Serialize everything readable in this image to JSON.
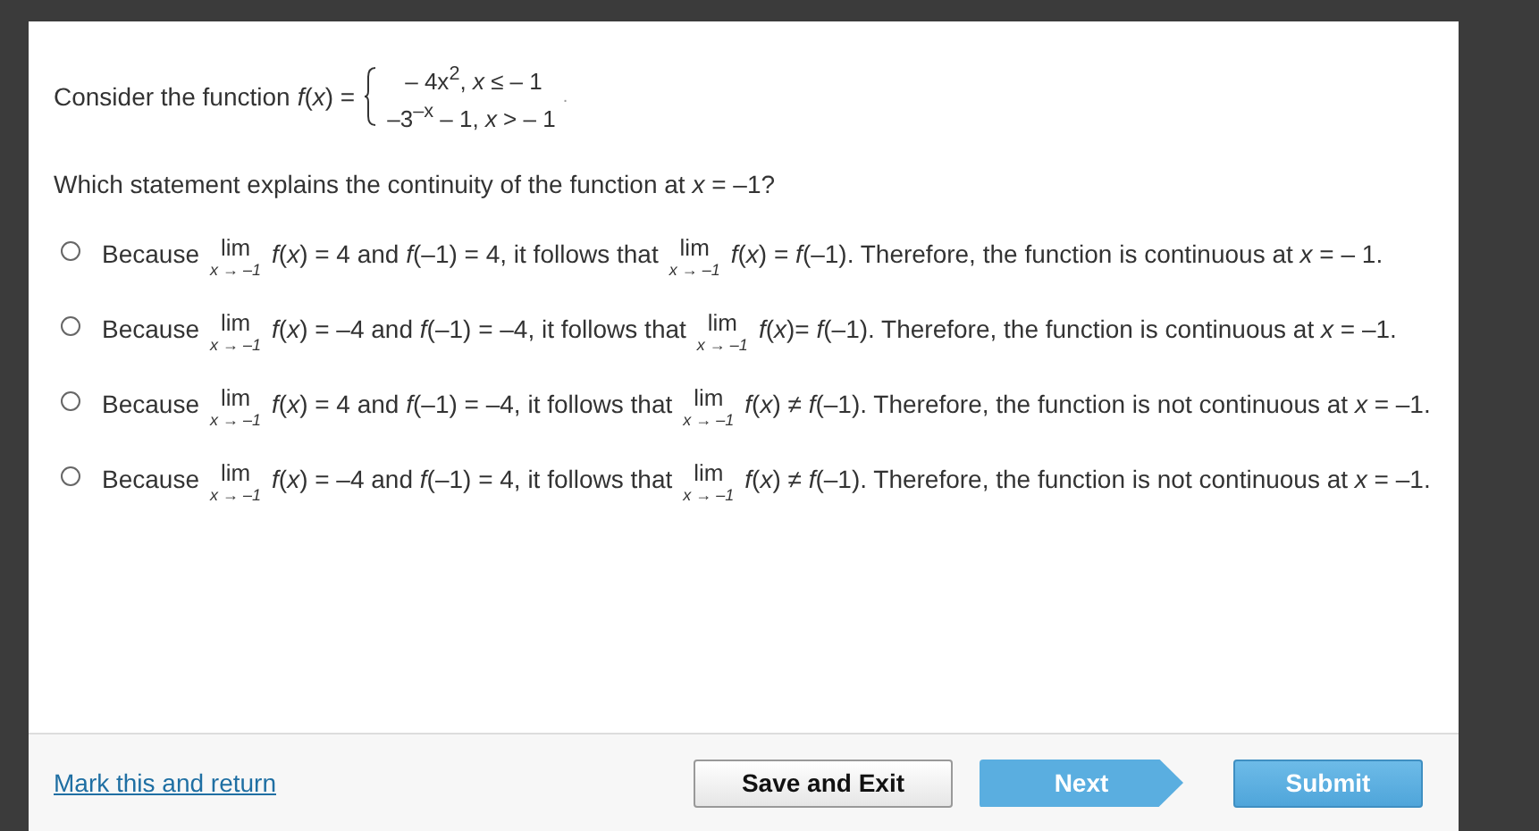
{
  "question": {
    "intro": "Consider the function",
    "function_label": "*f*(*x*) =",
    "cases": [
      "– 4x$^{2}$, *x* ≤ – 1",
      "–3$^{–x}$ – 1, *x* > – 1"
    ],
    "end": ".",
    "prompt": "Which statement explains the continuity of the function at *x* = –1?"
  },
  "options": [
    {
      "selected": false,
      "parts": [
        {
          "kind": "text",
          "text": "Because"
        },
        {
          "kind": "limit",
          "top": "lim",
          "sub": "x → –1"
        },
        {
          "kind": "text",
          "text": "*f*(*x*) = 4 and *f*(–1) = 4, it follows that"
        },
        {
          "kind": "limit",
          "top": "lim",
          "sub": "x → –1"
        },
        {
          "kind": "text",
          "text": "*f*(*x*) = *f*(–1). Therefore, the function is continuous at *x* = – 1."
        }
      ]
    },
    {
      "selected": false,
      "parts": [
        {
          "kind": "text",
          "text": "Because"
        },
        {
          "kind": "limit",
          "top": "lim",
          "sub": "x → –1"
        },
        {
          "kind": "text",
          "text": "*f*(*x*) = –4 and *f*(–1) = –4, it follows that"
        },
        {
          "kind": "limit",
          "top": "lim",
          "sub": "x → –1"
        },
        {
          "kind": "text",
          "text": "*f*(*x*)= *f*(–1). Therefore, the function is continuous at *x* = –1."
        }
      ]
    },
    {
      "selected": false,
      "parts": [
        {
          "kind": "text",
          "text": "Because"
        },
        {
          "kind": "limit",
          "top": "lim",
          "sub": "x → –1"
        },
        {
          "kind": "text",
          "text": "*f*(*x*) = 4 and *f*(–1) = –4, it follows that"
        },
        {
          "kind": "limit",
          "top": "lim",
          "sub": "x → –1"
        },
        {
          "kind": "text",
          "text": "*f*(*x*) ≠ *f*(–1). Therefore, the function is not continuous at *x* = –1."
        }
      ]
    },
    {
      "selected": false,
      "parts": [
        {
          "kind": "text",
          "text": "Because"
        },
        {
          "kind": "limit",
          "top": "lim",
          "sub": "x → –1"
        },
        {
          "kind": "text",
          "text": "*f*(*x*) = –4 and *f*(–1) = 4, it follows that"
        },
        {
          "kind": "limit",
          "top": "lim",
          "sub": "x → –1"
        },
        {
          "kind": "text",
          "text": "*f*(*x*) ≠ *f*(–1). Therefore, the function is not continuous at *x* = –1."
        }
      ]
    }
  ],
  "footer": {
    "link": "Mark this and return",
    "buttons": [
      {
        "kind": "plain",
        "label": "Save and Exit"
      },
      {
        "kind": "next",
        "label": "Next"
      },
      {
        "kind": "primary",
        "label": "Submit"
      }
    ]
  }
}
